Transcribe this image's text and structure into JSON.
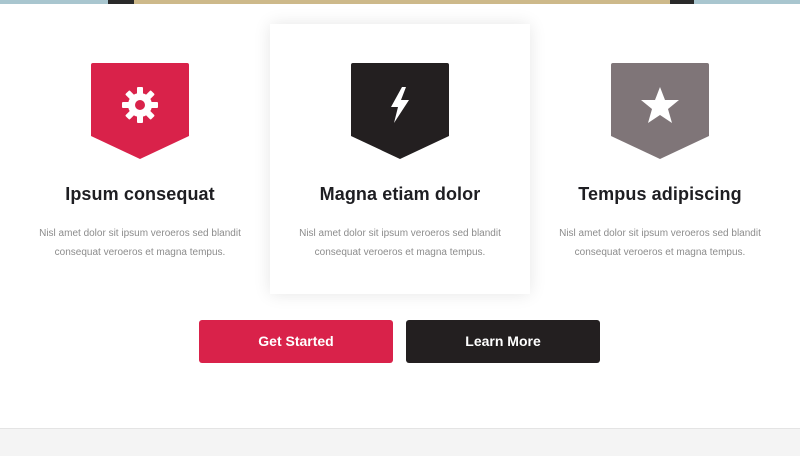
{
  "colors": {
    "accent": "#d9224a",
    "dark": "#231f20",
    "grey": "#7f7578"
  },
  "features": [
    {
      "icon": "gear-icon",
      "title": "Ipsum consequat",
      "text": "Nisl amet dolor sit ipsum veroeros sed blandit consequat veroeros et magna tempus."
    },
    {
      "icon": "bolt-icon",
      "title": "Magna etiam dolor",
      "text": "Nisl amet dolor sit ipsum veroeros sed blandit consequat veroeros et magna tempus."
    },
    {
      "icon": "star-icon",
      "title": "Tempus adipiscing",
      "text": "Nisl amet dolor sit ipsum veroeros sed blandit consequat veroeros et magna tempus."
    }
  ],
  "actions": {
    "primary_label": "Get Started",
    "secondary_label": "Learn More"
  }
}
